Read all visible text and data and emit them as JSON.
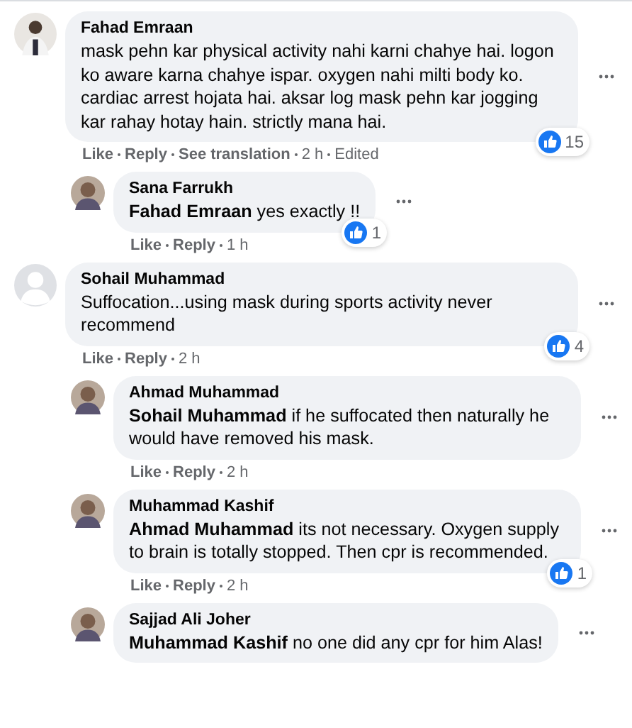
{
  "comments": [
    {
      "author": "Fahad Emraan",
      "avatar": {
        "kind": "picture"
      },
      "text": "mask pehn kar physical activity nahi karni chahye hai. logon ko aware karna chahye ispar. oxygen nahi milti body ko. cardiac arrest hojata hai. aksar log mask pehn kar jogging kar rahay hotay hain. strictly mana hai.",
      "reactions": "15",
      "links": [
        "Like",
        "Reply",
        "See translation"
      ],
      "meta": [
        "2 h",
        "Edited"
      ],
      "replies": [
        {
          "author": "Sana Farrukh",
          "avatar": {
            "kind": "picture"
          },
          "text": "**Fahad Emraan** yes exactly !!",
          "reactions": "1",
          "links": [
            "Like",
            "Reply"
          ],
          "meta": [
            "1 h"
          ]
        }
      ]
    },
    {
      "author": "Sohail Muhammad",
      "avatar": {
        "kind": "default"
      },
      "text": "Suffocation...using mask during sports activity never recommend",
      "reactions": "4",
      "links": [
        "Like",
        "Reply"
      ],
      "meta": [
        "2 h"
      ],
      "replies": [
        {
          "author": "Ahmad Muhammad",
          "avatar": {
            "kind": "picture"
          },
          "text": "**Sohail Muhammad** if he suffocated then naturally he would have removed his mask.",
          "links": [
            "Like",
            "Reply"
          ],
          "meta": [
            "2 h"
          ]
        },
        {
          "author": "Muhammad Kashif",
          "avatar": {
            "kind": "picture"
          },
          "text": "**Ahmad Muhammad** its not necessary. Oxygen supply to brain is totally stopped. Then cpr is recommended.",
          "reactions": "1",
          "links": [
            "Like",
            "Reply"
          ],
          "meta": [
            "2 h"
          ]
        },
        {
          "author": "Sajjad Ali Joher",
          "avatar": {
            "kind": "picture"
          },
          "text": "**Muhammad Kashif** no one did any cpr for him Alas!"
        }
      ]
    }
  ]
}
